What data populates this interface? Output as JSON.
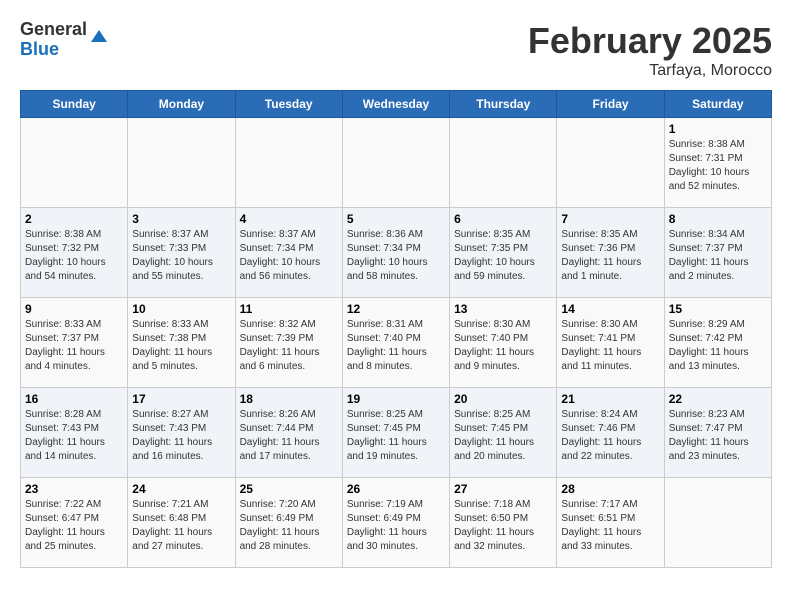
{
  "logo": {
    "line1": "General",
    "line2": "Blue"
  },
  "title": "February 2025",
  "subtitle": "Tarfaya, Morocco",
  "weekdays": [
    "Sunday",
    "Monday",
    "Tuesday",
    "Wednesday",
    "Thursday",
    "Friday",
    "Saturday"
  ],
  "weeks": [
    [
      {
        "day": "",
        "info": ""
      },
      {
        "day": "",
        "info": ""
      },
      {
        "day": "",
        "info": ""
      },
      {
        "day": "",
        "info": ""
      },
      {
        "day": "",
        "info": ""
      },
      {
        "day": "",
        "info": ""
      },
      {
        "day": "1",
        "info": "Sunrise: 8:38 AM\nSunset: 7:31 PM\nDaylight: 10 hours\nand 52 minutes."
      }
    ],
    [
      {
        "day": "2",
        "info": "Sunrise: 8:38 AM\nSunset: 7:32 PM\nDaylight: 10 hours\nand 54 minutes."
      },
      {
        "day": "3",
        "info": "Sunrise: 8:37 AM\nSunset: 7:33 PM\nDaylight: 10 hours\nand 55 minutes."
      },
      {
        "day": "4",
        "info": "Sunrise: 8:37 AM\nSunset: 7:34 PM\nDaylight: 10 hours\nand 56 minutes."
      },
      {
        "day": "5",
        "info": "Sunrise: 8:36 AM\nSunset: 7:34 PM\nDaylight: 10 hours\nand 58 minutes."
      },
      {
        "day": "6",
        "info": "Sunrise: 8:35 AM\nSunset: 7:35 PM\nDaylight: 10 hours\nand 59 minutes."
      },
      {
        "day": "7",
        "info": "Sunrise: 8:35 AM\nSunset: 7:36 PM\nDaylight: 11 hours\nand 1 minute."
      },
      {
        "day": "8",
        "info": "Sunrise: 8:34 AM\nSunset: 7:37 PM\nDaylight: 11 hours\nand 2 minutes."
      }
    ],
    [
      {
        "day": "9",
        "info": "Sunrise: 8:33 AM\nSunset: 7:37 PM\nDaylight: 11 hours\nand 4 minutes."
      },
      {
        "day": "10",
        "info": "Sunrise: 8:33 AM\nSunset: 7:38 PM\nDaylight: 11 hours\nand 5 minutes."
      },
      {
        "day": "11",
        "info": "Sunrise: 8:32 AM\nSunset: 7:39 PM\nDaylight: 11 hours\nand 6 minutes."
      },
      {
        "day": "12",
        "info": "Sunrise: 8:31 AM\nSunset: 7:40 PM\nDaylight: 11 hours\nand 8 minutes."
      },
      {
        "day": "13",
        "info": "Sunrise: 8:30 AM\nSunset: 7:40 PM\nDaylight: 11 hours\nand 9 minutes."
      },
      {
        "day": "14",
        "info": "Sunrise: 8:30 AM\nSunset: 7:41 PM\nDaylight: 11 hours\nand 11 minutes."
      },
      {
        "day": "15",
        "info": "Sunrise: 8:29 AM\nSunset: 7:42 PM\nDaylight: 11 hours\nand 13 minutes."
      }
    ],
    [
      {
        "day": "16",
        "info": "Sunrise: 8:28 AM\nSunset: 7:43 PM\nDaylight: 11 hours\nand 14 minutes."
      },
      {
        "day": "17",
        "info": "Sunrise: 8:27 AM\nSunset: 7:43 PM\nDaylight: 11 hours\nand 16 minutes."
      },
      {
        "day": "18",
        "info": "Sunrise: 8:26 AM\nSunset: 7:44 PM\nDaylight: 11 hours\nand 17 minutes."
      },
      {
        "day": "19",
        "info": "Sunrise: 8:25 AM\nSunset: 7:45 PM\nDaylight: 11 hours\nand 19 minutes."
      },
      {
        "day": "20",
        "info": "Sunrise: 8:25 AM\nSunset: 7:45 PM\nDaylight: 11 hours\nand 20 minutes."
      },
      {
        "day": "21",
        "info": "Sunrise: 8:24 AM\nSunset: 7:46 PM\nDaylight: 11 hours\nand 22 minutes."
      },
      {
        "day": "22",
        "info": "Sunrise: 8:23 AM\nSunset: 7:47 PM\nDaylight: 11 hours\nand 23 minutes."
      }
    ],
    [
      {
        "day": "23",
        "info": "Sunrise: 7:22 AM\nSunset: 6:47 PM\nDaylight: 11 hours\nand 25 minutes."
      },
      {
        "day": "24",
        "info": "Sunrise: 7:21 AM\nSunset: 6:48 PM\nDaylight: 11 hours\nand 27 minutes."
      },
      {
        "day": "25",
        "info": "Sunrise: 7:20 AM\nSunset: 6:49 PM\nDaylight: 11 hours\nand 28 minutes."
      },
      {
        "day": "26",
        "info": "Sunrise: 7:19 AM\nSunset: 6:49 PM\nDaylight: 11 hours\nand 30 minutes."
      },
      {
        "day": "27",
        "info": "Sunrise: 7:18 AM\nSunset: 6:50 PM\nDaylight: 11 hours\nand 32 minutes."
      },
      {
        "day": "28",
        "info": "Sunrise: 7:17 AM\nSunset: 6:51 PM\nDaylight: 11 hours\nand 33 minutes."
      },
      {
        "day": "",
        "info": ""
      }
    ]
  ]
}
